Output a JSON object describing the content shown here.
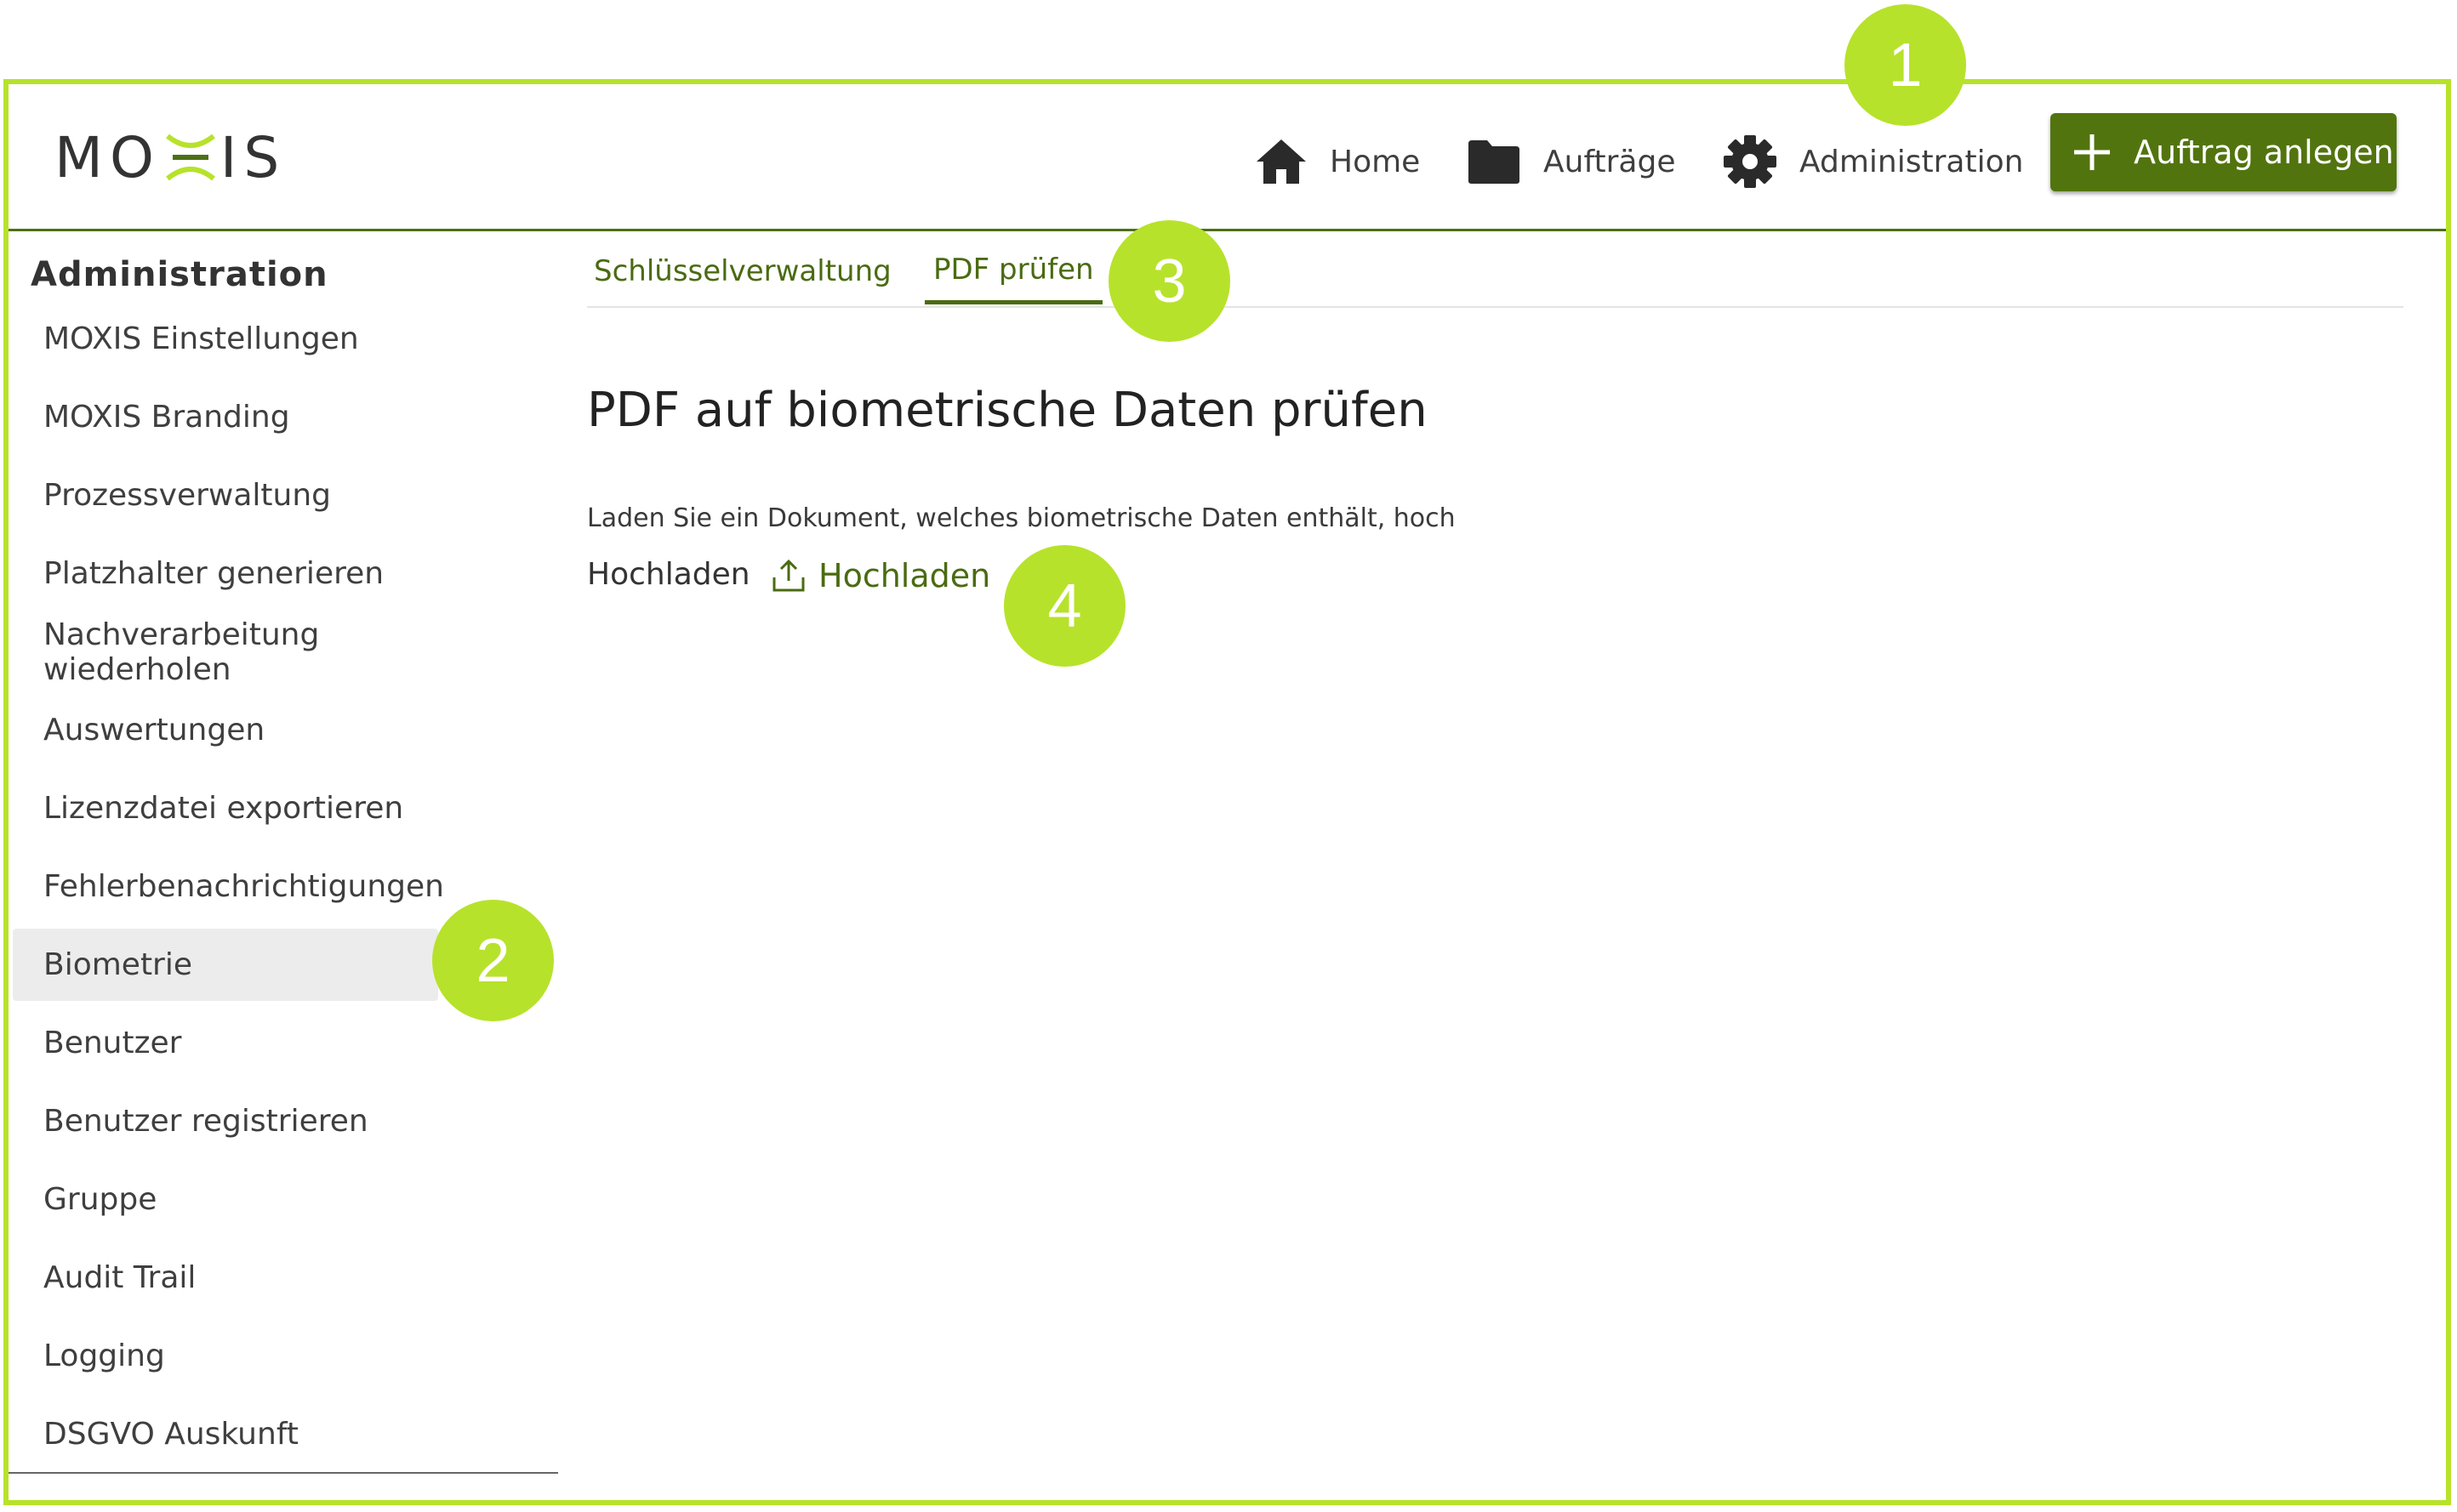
{
  "brand": {
    "logo_left": "MO",
    "logo_right": "IS"
  },
  "nav": {
    "home": "Home",
    "orders": "Aufträge",
    "admin": "Administration",
    "create": "Auftrag anlegen"
  },
  "sidebar": {
    "title": "Administration",
    "items": [
      {
        "label": "MOXIS Einstellungen"
      },
      {
        "label": "MOXIS Branding"
      },
      {
        "label": "Prozessverwaltung"
      },
      {
        "label": "Platzhalter generieren"
      },
      {
        "label": "Nachverarbeitung wiederholen"
      },
      {
        "label": "Auswertungen"
      },
      {
        "label": "Lizenzdatei exportieren"
      },
      {
        "label": "Fehlerbenachrichtigungen"
      },
      {
        "label": "Biometrie"
      },
      {
        "label": "Benutzer"
      },
      {
        "label": "Benutzer registrieren"
      },
      {
        "label": "Gruppe"
      },
      {
        "label": "Audit Trail"
      },
      {
        "label": "Logging"
      },
      {
        "label": "DSGVO Auskunft"
      }
    ],
    "active_item": "Biometrie"
  },
  "tabs": [
    {
      "label": "Schlüsselverwaltung"
    },
    {
      "label": "PDF prüfen"
    }
  ],
  "active_tab": "PDF prüfen",
  "main": {
    "title": "PDF auf biometrische Daten prüfen",
    "description": "Laden Sie ein Dokument, welches biometrische Daten enthält, hoch",
    "upload_label": "Hochladen",
    "upload_button": "Hochladen"
  },
  "annotations": [
    "1",
    "2",
    "3",
    "4"
  ],
  "colors": {
    "accent_green": "#52740f",
    "annotation_lime": "#b7e22b",
    "link_green": "#4a6b12"
  },
  "icons": {
    "home": "home-icon",
    "orders": "folder-icon",
    "admin": "gear-icon",
    "create": "plus-icon",
    "upload": "upload-icon",
    "logo": "moxis-x-icon"
  }
}
